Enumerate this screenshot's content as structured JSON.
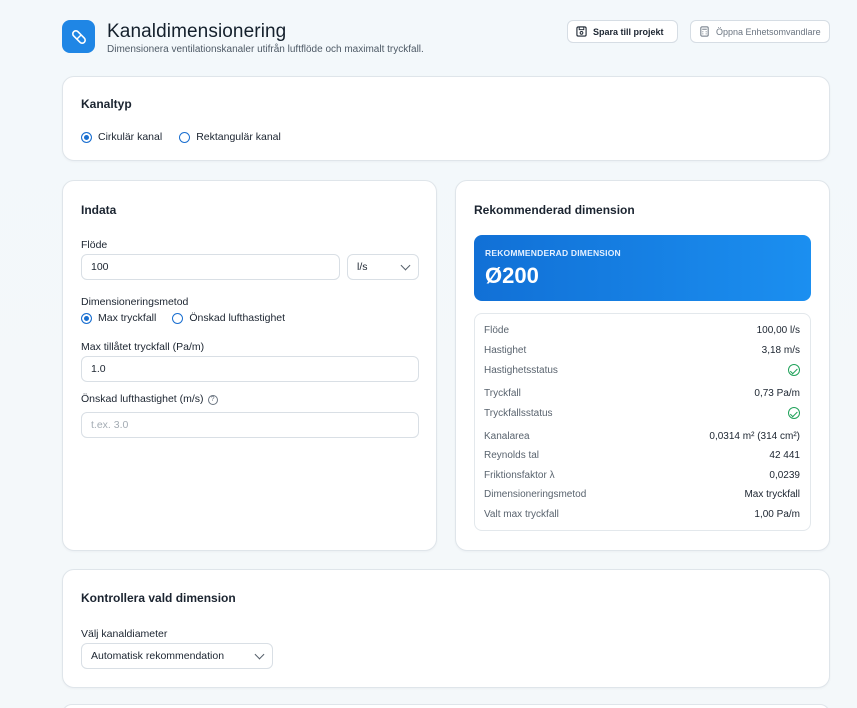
{
  "header": {
    "title": "Kanaldimensionering",
    "subtitle": "Dimensionera ventilationskanaler utifrån luftflöde och maximalt tryckfall.",
    "save_label": "Spara till projekt",
    "converter_label": "Öppna Enhetsomvandlare",
    "app_icon": "pipe-icon"
  },
  "kanaltyp": {
    "title": "Kanaltyp",
    "options": [
      "Cirkulär kanal",
      "Rektangulär kanal"
    ],
    "selected": "Cirkulär kanal"
  },
  "indata": {
    "title": "Indata",
    "flow_label": "Flöde",
    "flow_value": "100",
    "flow_unit": "l/s",
    "method_label": "Dimensioneringsmetod",
    "method_options": [
      "Max tryckfall",
      "Önskad lufthastighet"
    ],
    "method_selected": "Max tryckfall",
    "max_drop_label": "Max tillåtet tryckfall (Pa/m)",
    "max_drop_value": "1.0",
    "velocity_label": "Önskad lufthastighet (m/s)",
    "velocity_placeholder": "t.ex. 3.0"
  },
  "recommendation": {
    "title": "Rekommenderad dimension",
    "banner_label": "REKOMMENDERAD DIMENSION",
    "banner_value": "Ø200",
    "rows": [
      {
        "key": "Flöde",
        "value": "100,00 l/s"
      },
      {
        "key": "Hastighet",
        "value": "3,18 m/s"
      },
      {
        "key": "Hastighetsstatus",
        "value": "",
        "icon": "check-circle-icon"
      },
      {
        "key": "Tryckfall",
        "value": "0,73 Pa/m"
      },
      {
        "key": "Tryckfallsstatus",
        "value": "",
        "icon": "check-circle-icon"
      },
      {
        "key": "Kanalarea",
        "value": "0,0314 m² (314 cm²)"
      },
      {
        "key": "Reynolds tal",
        "value": "42 441"
      },
      {
        "key": "Friktionsfaktor λ",
        "value": "0,0239"
      },
      {
        "key": "Dimensioneringsmetod",
        "value": "Max tryckfall"
      },
      {
        "key": "Valt max tryckfall",
        "value": "1,00 Pa/m"
      }
    ]
  },
  "control": {
    "title": "Kontrollera vald dimension",
    "diameter_label": "Välj kanaldiameter",
    "diameter_value": "Automatisk rekommendation"
  },
  "colors": {
    "accent": "#1f86e5",
    "status_ok": "#20a25a"
  }
}
